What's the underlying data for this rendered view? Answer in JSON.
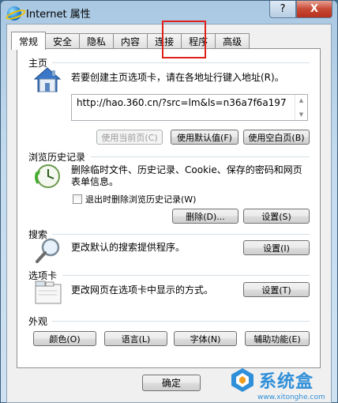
{
  "window": {
    "title": "Internet 属性",
    "help_label": "?",
    "close_label": "X"
  },
  "tabs": [
    {
      "label": "常规",
      "active": true
    },
    {
      "label": "安全"
    },
    {
      "label": "隐私"
    },
    {
      "label": "内容"
    },
    {
      "label": "连接",
      "highlighted": true
    },
    {
      "label": "程序"
    },
    {
      "label": "高级"
    }
  ],
  "homepage": {
    "heading": "主页",
    "description": "若要创建主页选项卡，请在各地址行键入地址(R)。",
    "url": "http://hao.360.cn/?src=lm&ls=n36a7f6a197",
    "btn_current": "使用当前页(C)",
    "btn_default": "使用默认值(F)",
    "btn_blank": "使用空白页(B)"
  },
  "history": {
    "heading": "浏览历史记录",
    "description_line1": "删除临时文件、历史记录、Cookie、保存的密码和网页",
    "description_line2": "表单信息。",
    "checkbox_label": "退出时删除浏览历史记录(W)",
    "btn_delete": "删除(D)...",
    "btn_settings": "设置(S)"
  },
  "search": {
    "heading": "搜索",
    "description": "更改默认的搜索提供程序。",
    "btn_settings": "设置(I)"
  },
  "tabs_section": {
    "heading": "选项卡",
    "description": "更改网页在选项卡中显示的方式。",
    "btn_settings": "设置(T)"
  },
  "appearance": {
    "heading": "外观",
    "btn_colors": "颜色(O)",
    "btn_languages": "语言(L)",
    "btn_fonts": "字体(N)",
    "btn_accessibility": "辅助功能(E)"
  },
  "footer": {
    "btn_ok": "确定"
  },
  "watermark": {
    "text": "系统盒",
    "url": "www.xitonghe.com"
  }
}
